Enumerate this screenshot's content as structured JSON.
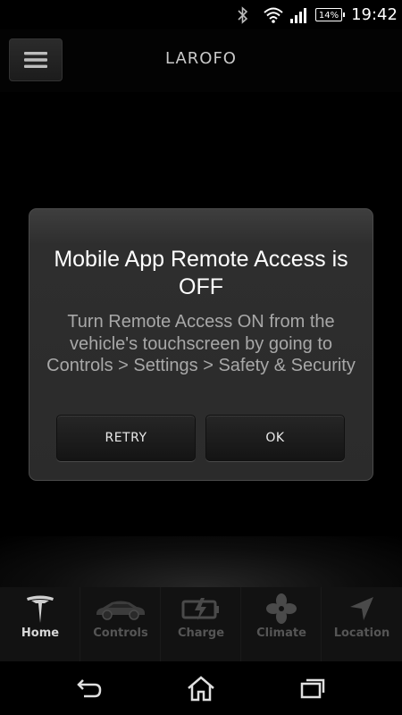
{
  "status_bar": {
    "battery": "14%",
    "time": "19:42",
    "icons": [
      "bluetooth-icon",
      "wifi-icon",
      "signal-icon",
      "battery-icon"
    ]
  },
  "header": {
    "title": "LAROFO",
    "menu_icon": "hamburger-menu-icon"
  },
  "dialog": {
    "title": "Mobile App Remote Access is OFF",
    "message": "Turn Remote Access ON from the vehicle's touchscreen by going to Controls > Settings > Safety & Security",
    "retry_label": "RETRY",
    "ok_label": "OK"
  },
  "tabs": [
    {
      "label": "Home",
      "icon": "tesla-logo-icon",
      "active": true
    },
    {
      "label": "Controls",
      "icon": "car-icon",
      "active": false
    },
    {
      "label": "Charge",
      "icon": "battery-charge-icon",
      "active": false
    },
    {
      "label": "Climate",
      "icon": "fan-icon",
      "active": false
    },
    {
      "label": "Location",
      "icon": "location-arrow-icon",
      "active": false
    }
  ],
  "nav_bar": {
    "icons": [
      "back-icon",
      "home-icon",
      "recent-apps-icon"
    ]
  },
  "colors": {
    "background": "#000000",
    "dialog": "#2e2e2e",
    "active_tab_label": "#d8d8d8",
    "inactive_tab": "#555555"
  }
}
